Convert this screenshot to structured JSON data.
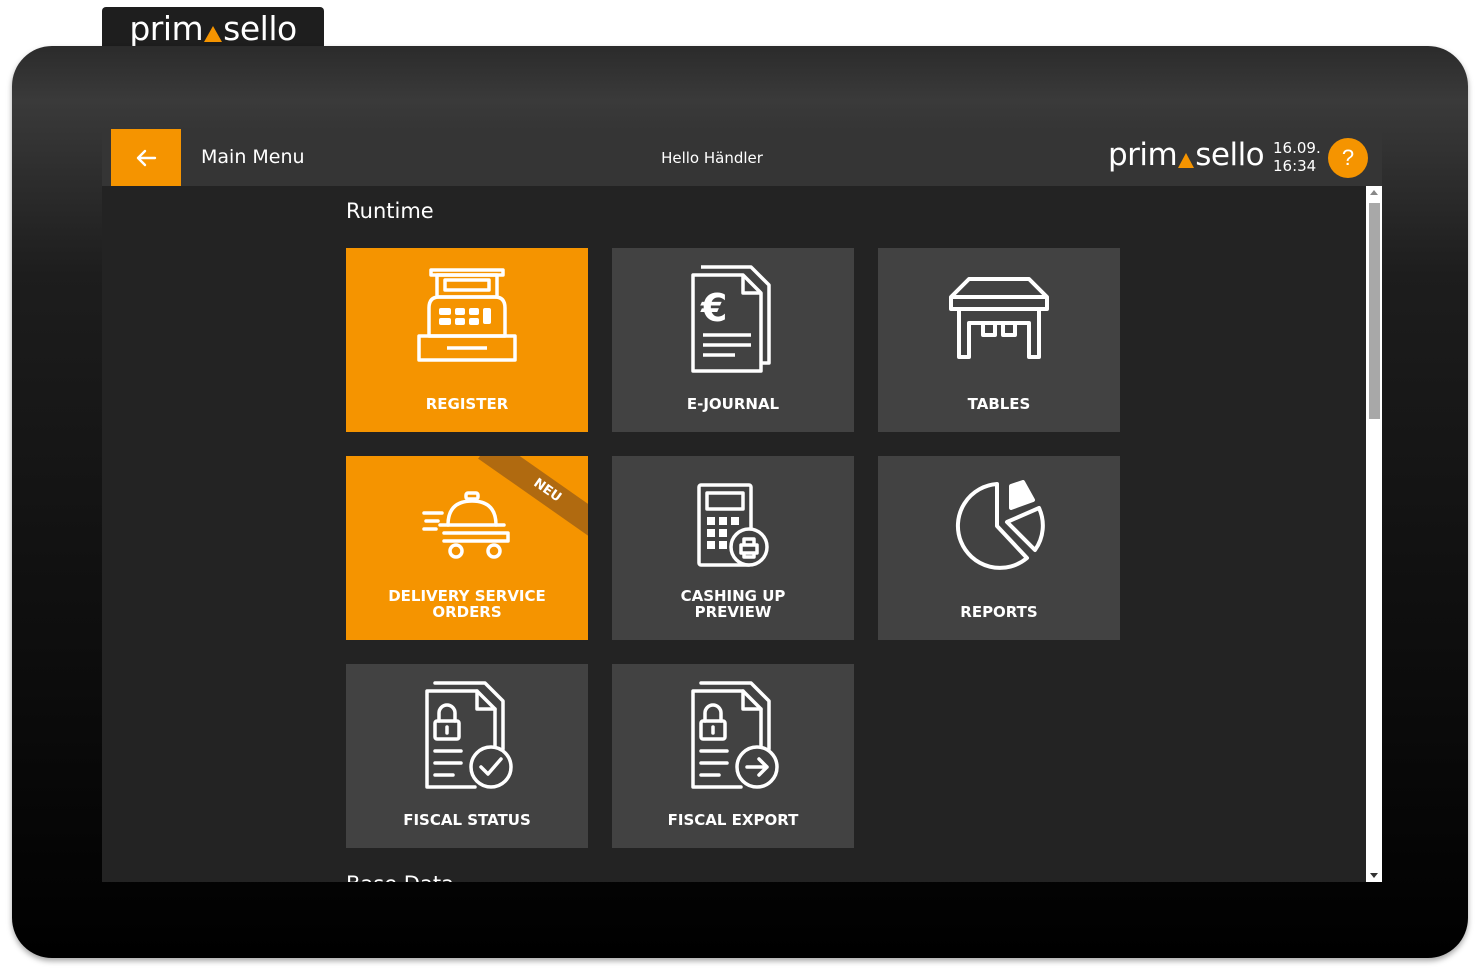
{
  "brand": {
    "logo_left": "prim",
    "logo_right": "sello"
  },
  "header": {
    "title": "Main Menu",
    "greeting": "Hello Händler",
    "date": "16.09.",
    "time": "16:34",
    "help_label": "?"
  },
  "sections": [
    {
      "title": "Runtime"
    },
    {
      "title": "Base Data"
    }
  ],
  "tiles": [
    {
      "label": "REGISTER",
      "icon": "cash-register-icon",
      "active": true
    },
    {
      "label": "E-JOURNAL",
      "icon": "journal-euro-icon",
      "active": false
    },
    {
      "label": "TABLES",
      "icon": "table-icon",
      "active": false
    },
    {
      "label_line1": "DELIVERY SERVICE",
      "label_line2": "ORDERS",
      "icon": "delivery-cloche-icon",
      "active": true,
      "badge": "NEU"
    },
    {
      "label_line1": "CASHING UP",
      "label_line2": "PREVIEW",
      "icon": "calculator-print-icon",
      "active": false
    },
    {
      "label": "REPORTS",
      "icon": "pie-chart-icon",
      "active": false
    },
    {
      "label": "FISCAL STATUS",
      "icon": "fiscal-status-icon",
      "active": false
    },
    {
      "label": "FISCAL EXPORT",
      "icon": "fiscal-export-icon",
      "active": false
    }
  ],
  "colors": {
    "accent": "#f59400",
    "tile": "#424242",
    "header": "#353535",
    "background": "#232323"
  }
}
